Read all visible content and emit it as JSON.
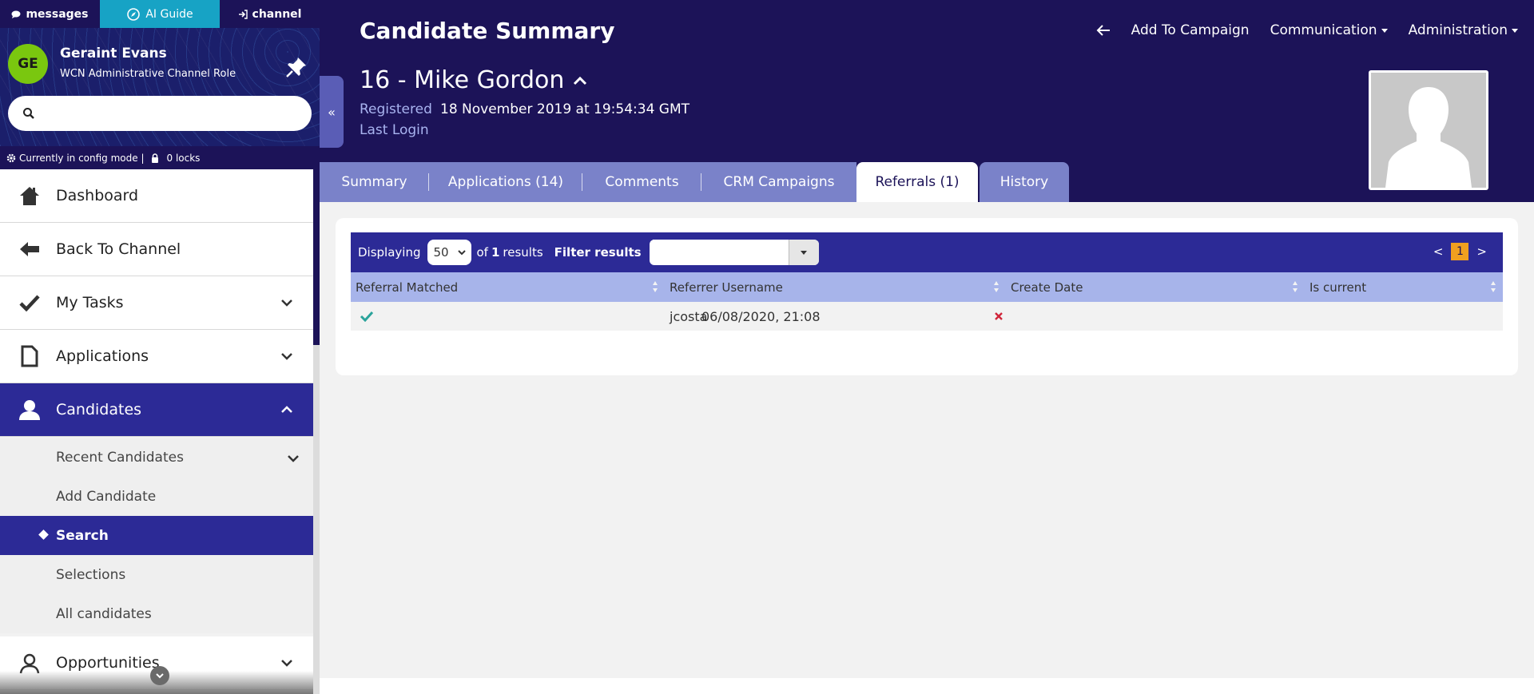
{
  "topbar": {
    "messages_label": "messages",
    "guide_label": "AI Guide",
    "channel_label": "channel"
  },
  "user": {
    "initials": "GE",
    "name": "Geraint Evans",
    "role": "WCN Administrative Channel Role",
    "avatar_color": "#7ac70f"
  },
  "sidebar_search": {
    "placeholder": "",
    "value": ""
  },
  "config_bar": {
    "mode_text": "Currently in config mode |",
    "locks_text": "0 locks"
  },
  "nav": {
    "dashboard": "Dashboard",
    "back_to_channel": "Back To Channel",
    "my_tasks": "My Tasks",
    "applications": "Applications",
    "candidates": "Candidates",
    "candidates_sub": {
      "recent": "Recent Candidates",
      "add": "Add Candidate",
      "search": "Search",
      "selections": "Selections",
      "all": "All candidates"
    },
    "opportunities": "Opportunities"
  },
  "header": {
    "title": "Candidate Summary",
    "actions": {
      "add_to_campaign": "Add To Campaign",
      "communication": "Communication",
      "administration": "Administration"
    },
    "candidate_name": "16 - Mike Gordon",
    "registered_label": "Registered",
    "registered_value": "18 November 2019 at 19:54:34 GMT",
    "last_login_label": "Last Login"
  },
  "tabs": {
    "summary": "Summary",
    "applications": "Applications (14)",
    "comments": "Comments",
    "crm": "CRM Campaigns",
    "referrals": "Referrals (1)",
    "history": "History",
    "active": "referrals"
  },
  "grid": {
    "displaying_label": "Displaying",
    "page_size": "50",
    "results_prefix": "of",
    "results_count": "1",
    "results_suffix": "results",
    "filter_label": "Filter results",
    "filter_value": "",
    "pager_prev": "<",
    "pager_current": "1",
    "pager_next": ">",
    "columns": [
      "Referral Matched",
      "Referrer Username",
      "Create Date",
      "Is current"
    ],
    "rows": [
      {
        "referral_matched": "check-icon",
        "referrer_username": "jcosta",
        "create_date": "06/08/2020, 21:08",
        "is_current": "cross-icon"
      }
    ]
  },
  "colors": {
    "navy": "#1c1358",
    "accent": "#2c2a96",
    "guide": "#17a3c5",
    "header_row": "#a7b4ea",
    "pager_current": "#f0a020",
    "check": "#2aa39b",
    "cross": "#d0253a"
  }
}
